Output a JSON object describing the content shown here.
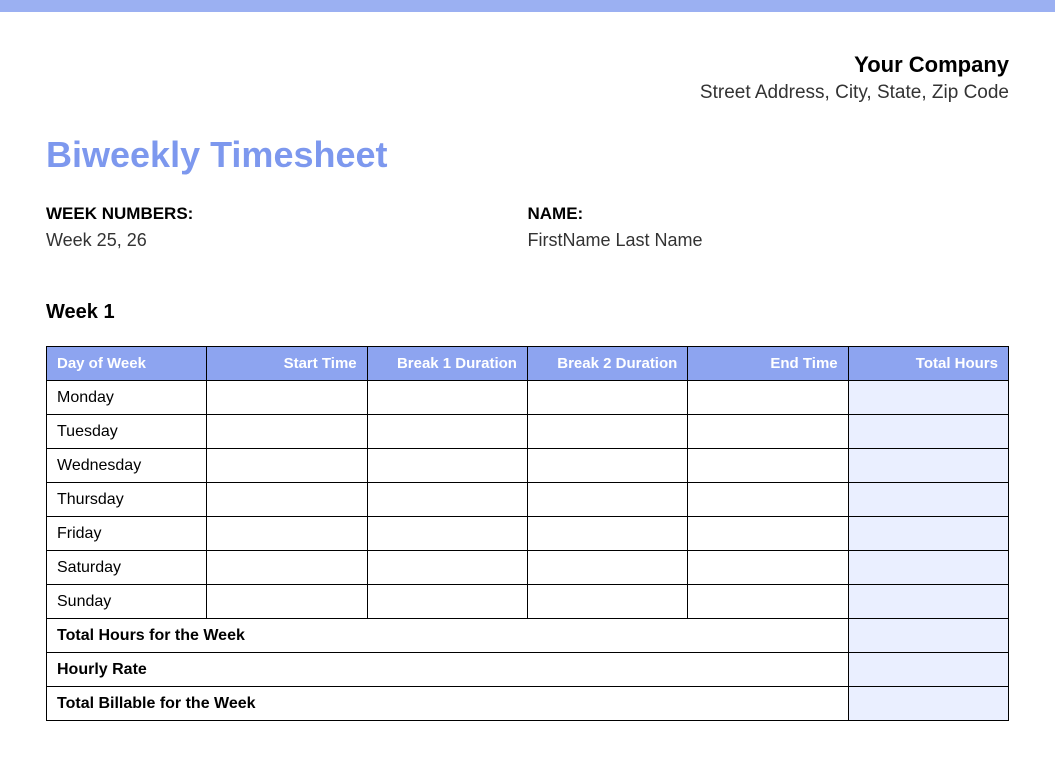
{
  "company": {
    "name": "Your Company",
    "address": "Street Address, City, State, Zip Code"
  },
  "title": "Biweekly Timesheet",
  "info": {
    "week_numbers_label": "WEEK NUMBERS:",
    "week_numbers_value": "Week 25, 26",
    "name_label": "NAME:",
    "name_value": "FirstName Last Name"
  },
  "week_title": "Week 1",
  "table": {
    "headers": {
      "day": "Day of Week",
      "start": "Start Time",
      "break1": "Break 1 Duration",
      "break2": "Break 2 Duration",
      "end": "End Time",
      "total": "Total Hours"
    },
    "days": [
      {
        "label": "Monday",
        "start": "",
        "break1": "",
        "break2": "",
        "end": "",
        "total": ""
      },
      {
        "label": "Tuesday",
        "start": "",
        "break1": "",
        "break2": "",
        "end": "",
        "total": ""
      },
      {
        "label": "Wednesday",
        "start": "",
        "break1": "",
        "break2": "",
        "end": "",
        "total": ""
      },
      {
        "label": "Thursday",
        "start": "",
        "break1": "",
        "break2": "",
        "end": "",
        "total": ""
      },
      {
        "label": "Friday",
        "start": "",
        "break1": "",
        "break2": "",
        "end": "",
        "total": ""
      },
      {
        "label": "Saturday",
        "start": "",
        "break1": "",
        "break2": "",
        "end": "",
        "total": ""
      },
      {
        "label": "Sunday",
        "start": "",
        "break1": "",
        "break2": "",
        "end": "",
        "total": ""
      }
    ],
    "summary": {
      "total_hours_label": "Total Hours for the Week",
      "total_hours_value": "",
      "hourly_rate_label": "Hourly Rate",
      "hourly_rate_value": "",
      "total_billable_label": "Total Billable for the Week",
      "total_billable_value": ""
    }
  }
}
